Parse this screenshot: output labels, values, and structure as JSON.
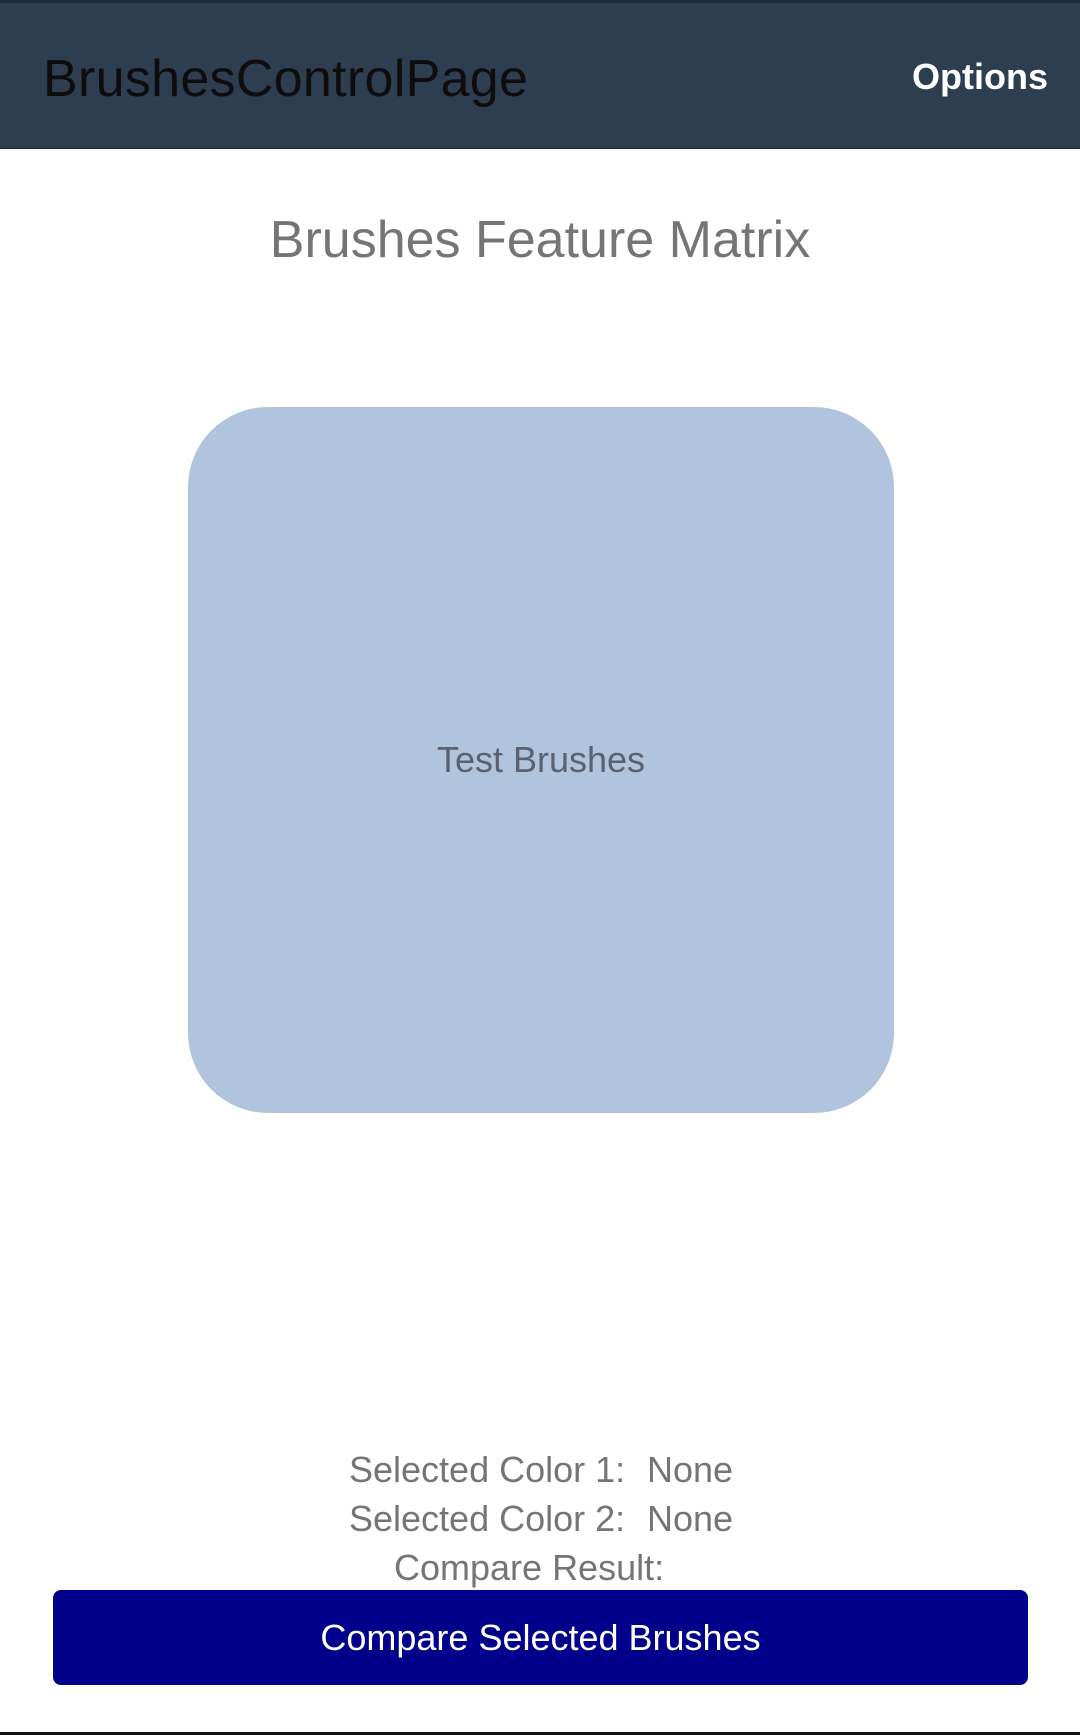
{
  "app_bar": {
    "title": "BrushesControlPage",
    "options_label": "Options"
  },
  "main": {
    "heading": "Brushes Feature Matrix",
    "test_box_label": "Test Brushes"
  },
  "selection": {
    "color1_label": "Selected Color 1:",
    "color1_value": "None",
    "color2_label": "Selected Color 2:",
    "color2_value": "None",
    "compare_result_label": "Compare Result:",
    "compare_result_value": ""
  },
  "actions": {
    "compare_button_label": "Compare Selected Brushes"
  },
  "colors": {
    "app_bar_bg": "#2d3e50",
    "test_box_bg": "#b0c4de",
    "compare_button_bg": "#00008b"
  }
}
